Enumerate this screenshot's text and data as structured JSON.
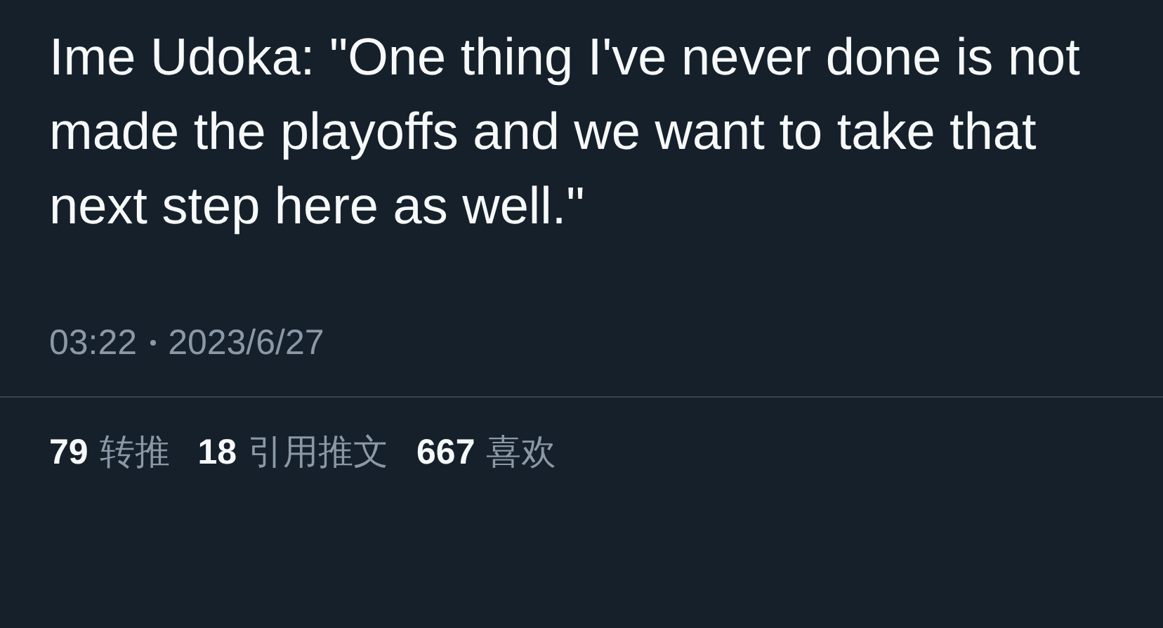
{
  "tweet": {
    "text": "Ime Udoka: \"One thing I've never done is not made the playoffs and we want to take that next step here as well.\"",
    "time": "03:22",
    "date": "2023/6/27"
  },
  "stats": [
    {
      "count": "79",
      "label": "转推"
    },
    {
      "count": "18",
      "label": "引用推文"
    },
    {
      "count": "667",
      "label": "喜欢"
    }
  ]
}
